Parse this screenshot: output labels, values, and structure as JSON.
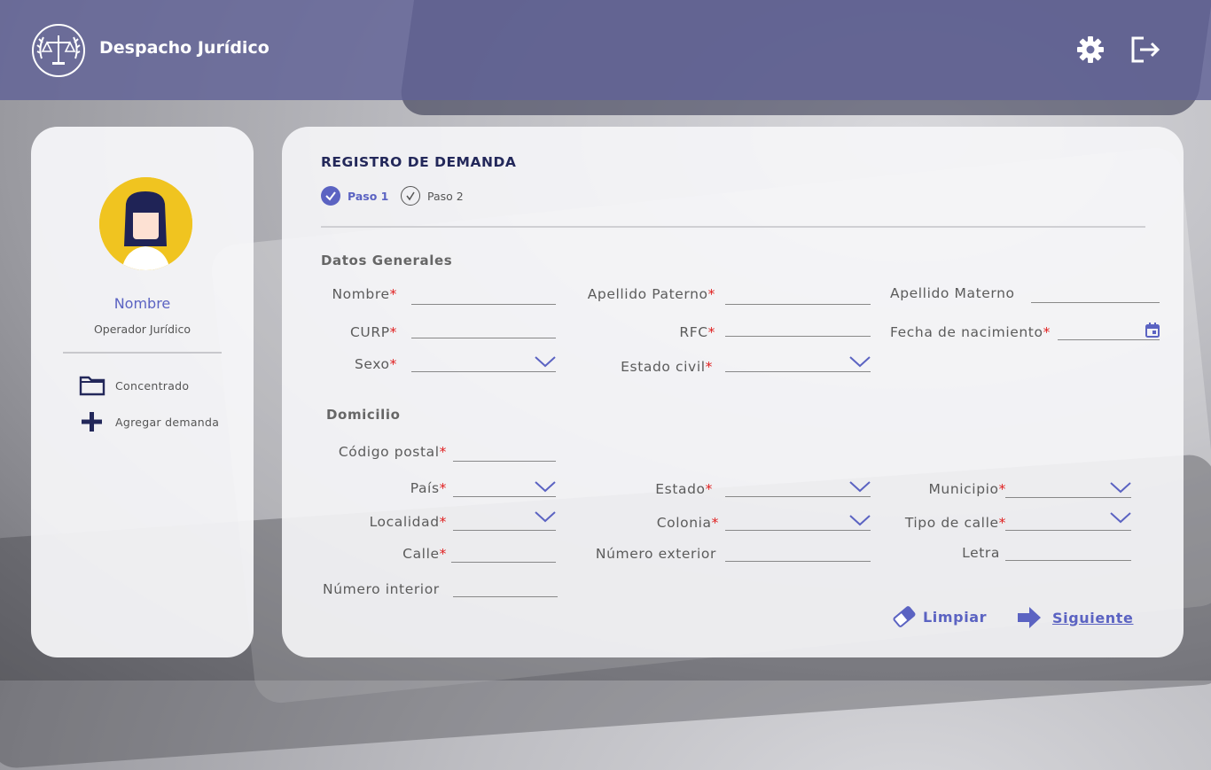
{
  "app": {
    "brand": "Despacho Jurídico",
    "accent": "#5b63c2",
    "header_color": "#606296"
  },
  "user": {
    "name": "Nombre",
    "role": "Operador Jurídico"
  },
  "nav": [
    {
      "label": "Concentrado",
      "icon": "folder-icon"
    },
    {
      "label": "Agregar demanda",
      "icon": "plus-icon"
    }
  ],
  "form": {
    "title": "REGISTRO DE DEMANDA",
    "steps": [
      {
        "label": "Paso 1",
        "active": true
      },
      {
        "label": "Paso 2",
        "active": false
      }
    ],
    "general_title": "Datos Generales",
    "address_title": "Domicilio",
    "fields": {
      "nombre": {
        "label": "Nombre",
        "required": "*",
        "value": ""
      },
      "apellido_paterno": {
        "label": "Apellido Paterno",
        "required": "*",
        "value": ""
      },
      "apellido_materno": {
        "label": "Apellido Materno",
        "value": ""
      },
      "curp": {
        "label": "CURP",
        "required": "*",
        "value": ""
      },
      "rfc": {
        "label": "RFC",
        "required": "*",
        "value": ""
      },
      "fecha_nacimiento": {
        "label": "Fecha de nacimiento",
        "required": "*",
        "value": ""
      },
      "sexo": {
        "label": "Sexo",
        "required": "*",
        "value": ""
      },
      "estado_civil": {
        "label": "Estado civil",
        "required": "*",
        "value": ""
      },
      "codigo_postal": {
        "label": "Código postal",
        "required": "*",
        "value": ""
      },
      "pais": {
        "label": "País",
        "required": "*",
        "value": ""
      },
      "estado": {
        "label": "Estado",
        "required": "*",
        "value": ""
      },
      "municipio": {
        "label": "Municipio",
        "required": "*",
        "value": ""
      },
      "localidad": {
        "label": "Localidad",
        "required": "*",
        "value": ""
      },
      "colonia": {
        "label": "Colonia",
        "required": "*",
        "value": ""
      },
      "tipo_calle": {
        "label": "Tipo de calle",
        "required": "*",
        "value": ""
      },
      "calle": {
        "label": "Calle",
        "required": "*",
        "value": ""
      },
      "numero_exterior": {
        "label": "Número exterior",
        "value": ""
      },
      "letra": {
        "label": "Letra",
        "value": ""
      },
      "numero_interior": {
        "label": "Número interior",
        "value": ""
      }
    },
    "actions": {
      "clear": "Limpiar",
      "next": "Siguiente"
    }
  }
}
